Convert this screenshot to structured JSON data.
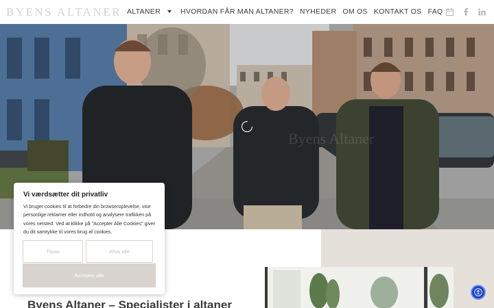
{
  "header": {
    "logo_text": "BYENS ALTANER",
    "nav": [
      {
        "label": "ALTANER",
        "has_dropdown": true
      },
      {
        "label": "HVORDAN FÅR MAN ALTANER?"
      },
      {
        "label": "NYHEDER"
      },
      {
        "label": "OM OS"
      },
      {
        "label": "KONTAKT OS"
      },
      {
        "label": "FAQ"
      }
    ],
    "social_icons": [
      "calendar-icon",
      "facebook-icon",
      "linkedin-icon"
    ]
  },
  "hero": {
    "video_watermark": "Byens Altaner"
  },
  "main": {
    "headline": "Byens Altaner – Specialister i altaner"
  },
  "cookie_banner": {
    "title": "Vi værdsætter dit privatliv",
    "body": "Vi bruger cookies til at forbedre din browseroplevelse, vise personlige reklamer eller indhold og analysere trafikken på vores netsted. Ved at klikke på \"Accepter Alle Cookies\" giver du dit samtykke til vores brug af cookies.",
    "customize_label": "Tilpas",
    "reject_label": "Afvis alle",
    "accept_label": "Accepter alle"
  },
  "accessibility": {
    "icon": "accessibility-icon"
  },
  "colors": {
    "accent_beige": "#e6e0da",
    "accept_button": "#d8d3ce",
    "a11y_blue": "#1a44c9",
    "text_dark": "#3a3a3a"
  }
}
